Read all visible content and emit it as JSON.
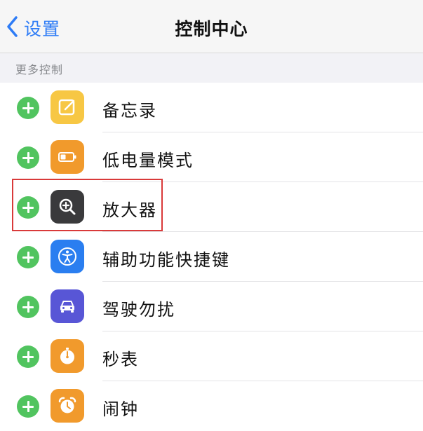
{
  "navbar": {
    "back_label": "设置",
    "title": "控制中心",
    "back_icon": "chevron-left-icon"
  },
  "section": {
    "header": "更多控制"
  },
  "items": [
    {
      "label": "备忘录",
      "icon": "notes-icon",
      "color": "#f7c744"
    },
    {
      "label": "低电量模式",
      "icon": "battery-icon",
      "color": "#f19a2c"
    },
    {
      "label": "放大器",
      "icon": "magnifier-icon",
      "color": "#3a3a3c",
      "highlighted": true
    },
    {
      "label": "辅助功能快捷键",
      "icon": "accessibility-icon",
      "color": "#2a7ef0"
    },
    {
      "label": "驾驶勿扰",
      "icon": "car-icon",
      "color": "#5856d6"
    },
    {
      "label": "秒表",
      "icon": "stopwatch-icon",
      "color": "#f19a2c"
    },
    {
      "label": "闹钟",
      "icon": "alarm-clock-icon",
      "color": "#f19a2c"
    }
  ],
  "colors": {
    "add_button": "#51c45f",
    "accent": "#2e7cf6",
    "highlight_border": "#d93a3a"
  }
}
